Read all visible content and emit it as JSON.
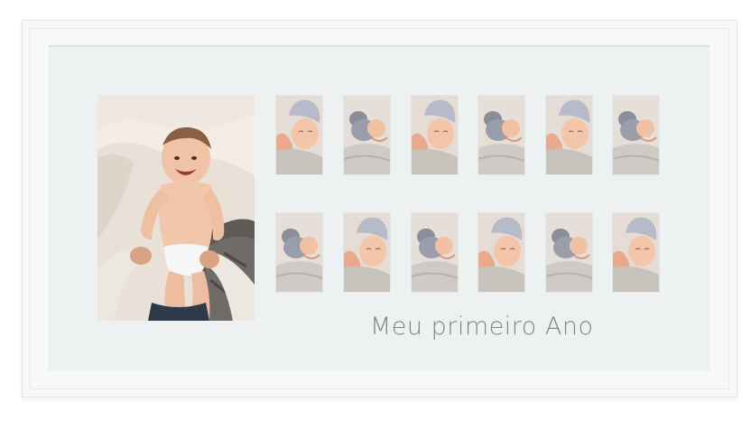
{
  "caption": "Meu primeiro Ano",
  "colors": {
    "frame": "#f7f8f8",
    "mat": "#eef1f1",
    "caption": "#7e8584",
    "skin": "#f2c2a5",
    "blanket": "#c9c2ba",
    "hat": "#b5b9c9"
  },
  "photos": {
    "main": "laughing-baby-photo",
    "grid_top": [
      "newborn-hat-photo",
      "newborn-bunny-photo",
      "newborn-hat-photo",
      "newborn-bunny-photo",
      "newborn-hat-photo",
      "newborn-bunny-photo"
    ],
    "grid_bottom": [
      "newborn-bunny-photo",
      "newborn-hat-photo",
      "newborn-bunny-photo",
      "newborn-hat-photo",
      "newborn-bunny-photo",
      "newborn-hat-photo"
    ]
  }
}
